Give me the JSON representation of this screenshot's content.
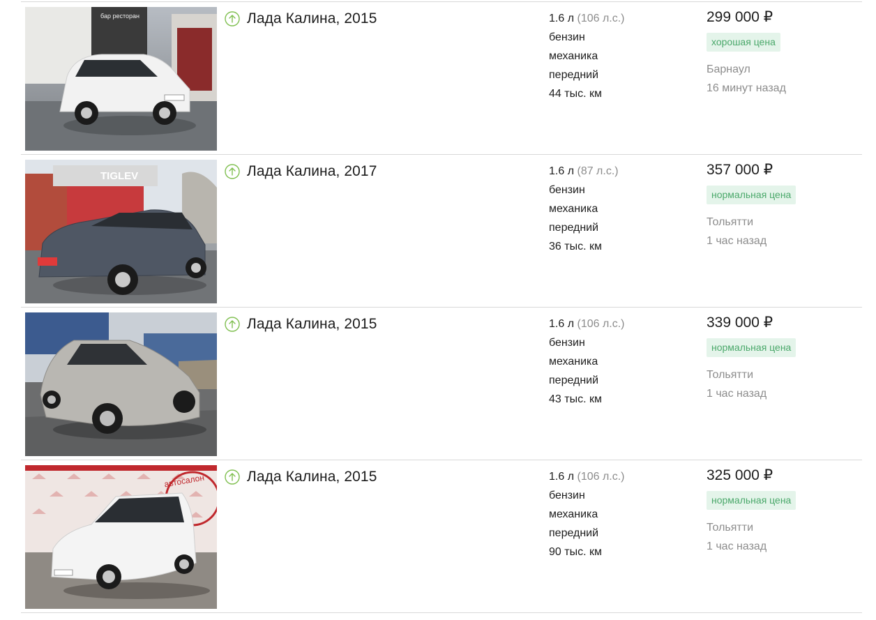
{
  "listings": [
    {
      "title": "Лада Калина, 2015",
      "engine": "1.6 л",
      "power": "(106 л.с.)",
      "fuel": "бензин",
      "transmission": "механика",
      "drive": "передний",
      "mileage": "44 тыс. км",
      "price": "299 000 ₽",
      "price_badge": "хорошая цена",
      "city": "Барнаул",
      "posted": "16 минут назад",
      "photo": {
        "car_color": "#f2f2f2",
        "bg_top": "#b7bcc3",
        "bg_bottom": "#7a7e82",
        "sign_text": "бар ресторан",
        "sign_color": "#2a2a2a"
      }
    },
    {
      "title": "Лада Калина, 2017",
      "engine": "1.6 л",
      "power": "(87 л.с.)",
      "fuel": "бензин",
      "transmission": "механика",
      "drive": "передний",
      "mileage": "36 тыс. км",
      "price": "357 000 ₽",
      "price_badge": "нормальная цена",
      "city": "Тольятти",
      "posted": "1 час назад",
      "photo": {
        "car_color": "#4f5764",
        "bg_top": "#c84a4a",
        "bg_bottom": "#7d7f82",
        "sign_text": "TIGLEV",
        "sign_color": "#ffffff"
      }
    },
    {
      "title": "Лада Калина, 2015",
      "engine": "1.6 л",
      "power": "(106 л.с.)",
      "fuel": "бензин",
      "transmission": "механика",
      "drive": "передний",
      "mileage": "43 тыс. км",
      "price": "339 000 ₽",
      "price_badge": "нормальная цена",
      "city": "Тольятти",
      "posted": "1 час назад",
      "photo": {
        "car_color": "#b9b7b2",
        "bg_top": "#c9cfd6",
        "bg_bottom": "#6c6d6e",
        "sign_text": "",
        "sign_color": "#ffffff"
      }
    },
    {
      "title": "Лада Калина, 2015",
      "engine": "1.6 л",
      "power": "(106 л.с.)",
      "fuel": "бензин",
      "transmission": "механика",
      "drive": "передний",
      "mileage": "90 тыс. км",
      "price": "325 000 ₽",
      "price_badge": "нормальная цена",
      "city": "Тольятти",
      "posted": "1 час назад",
      "photo": {
        "car_color": "#f4f4f4",
        "bg_top": "#e8c9c9",
        "bg_bottom": "#8f8a84",
        "sign_text": "автосалон",
        "sign_color": "#c0282d"
      }
    }
  ],
  "colors": {
    "accent_green": "#4aa86a",
    "badge_bg": "#e4f4ea",
    "muted_text": "#8c8c8c",
    "divider": "#d8d8d8",
    "up_icon": "#7fbf4f"
  }
}
